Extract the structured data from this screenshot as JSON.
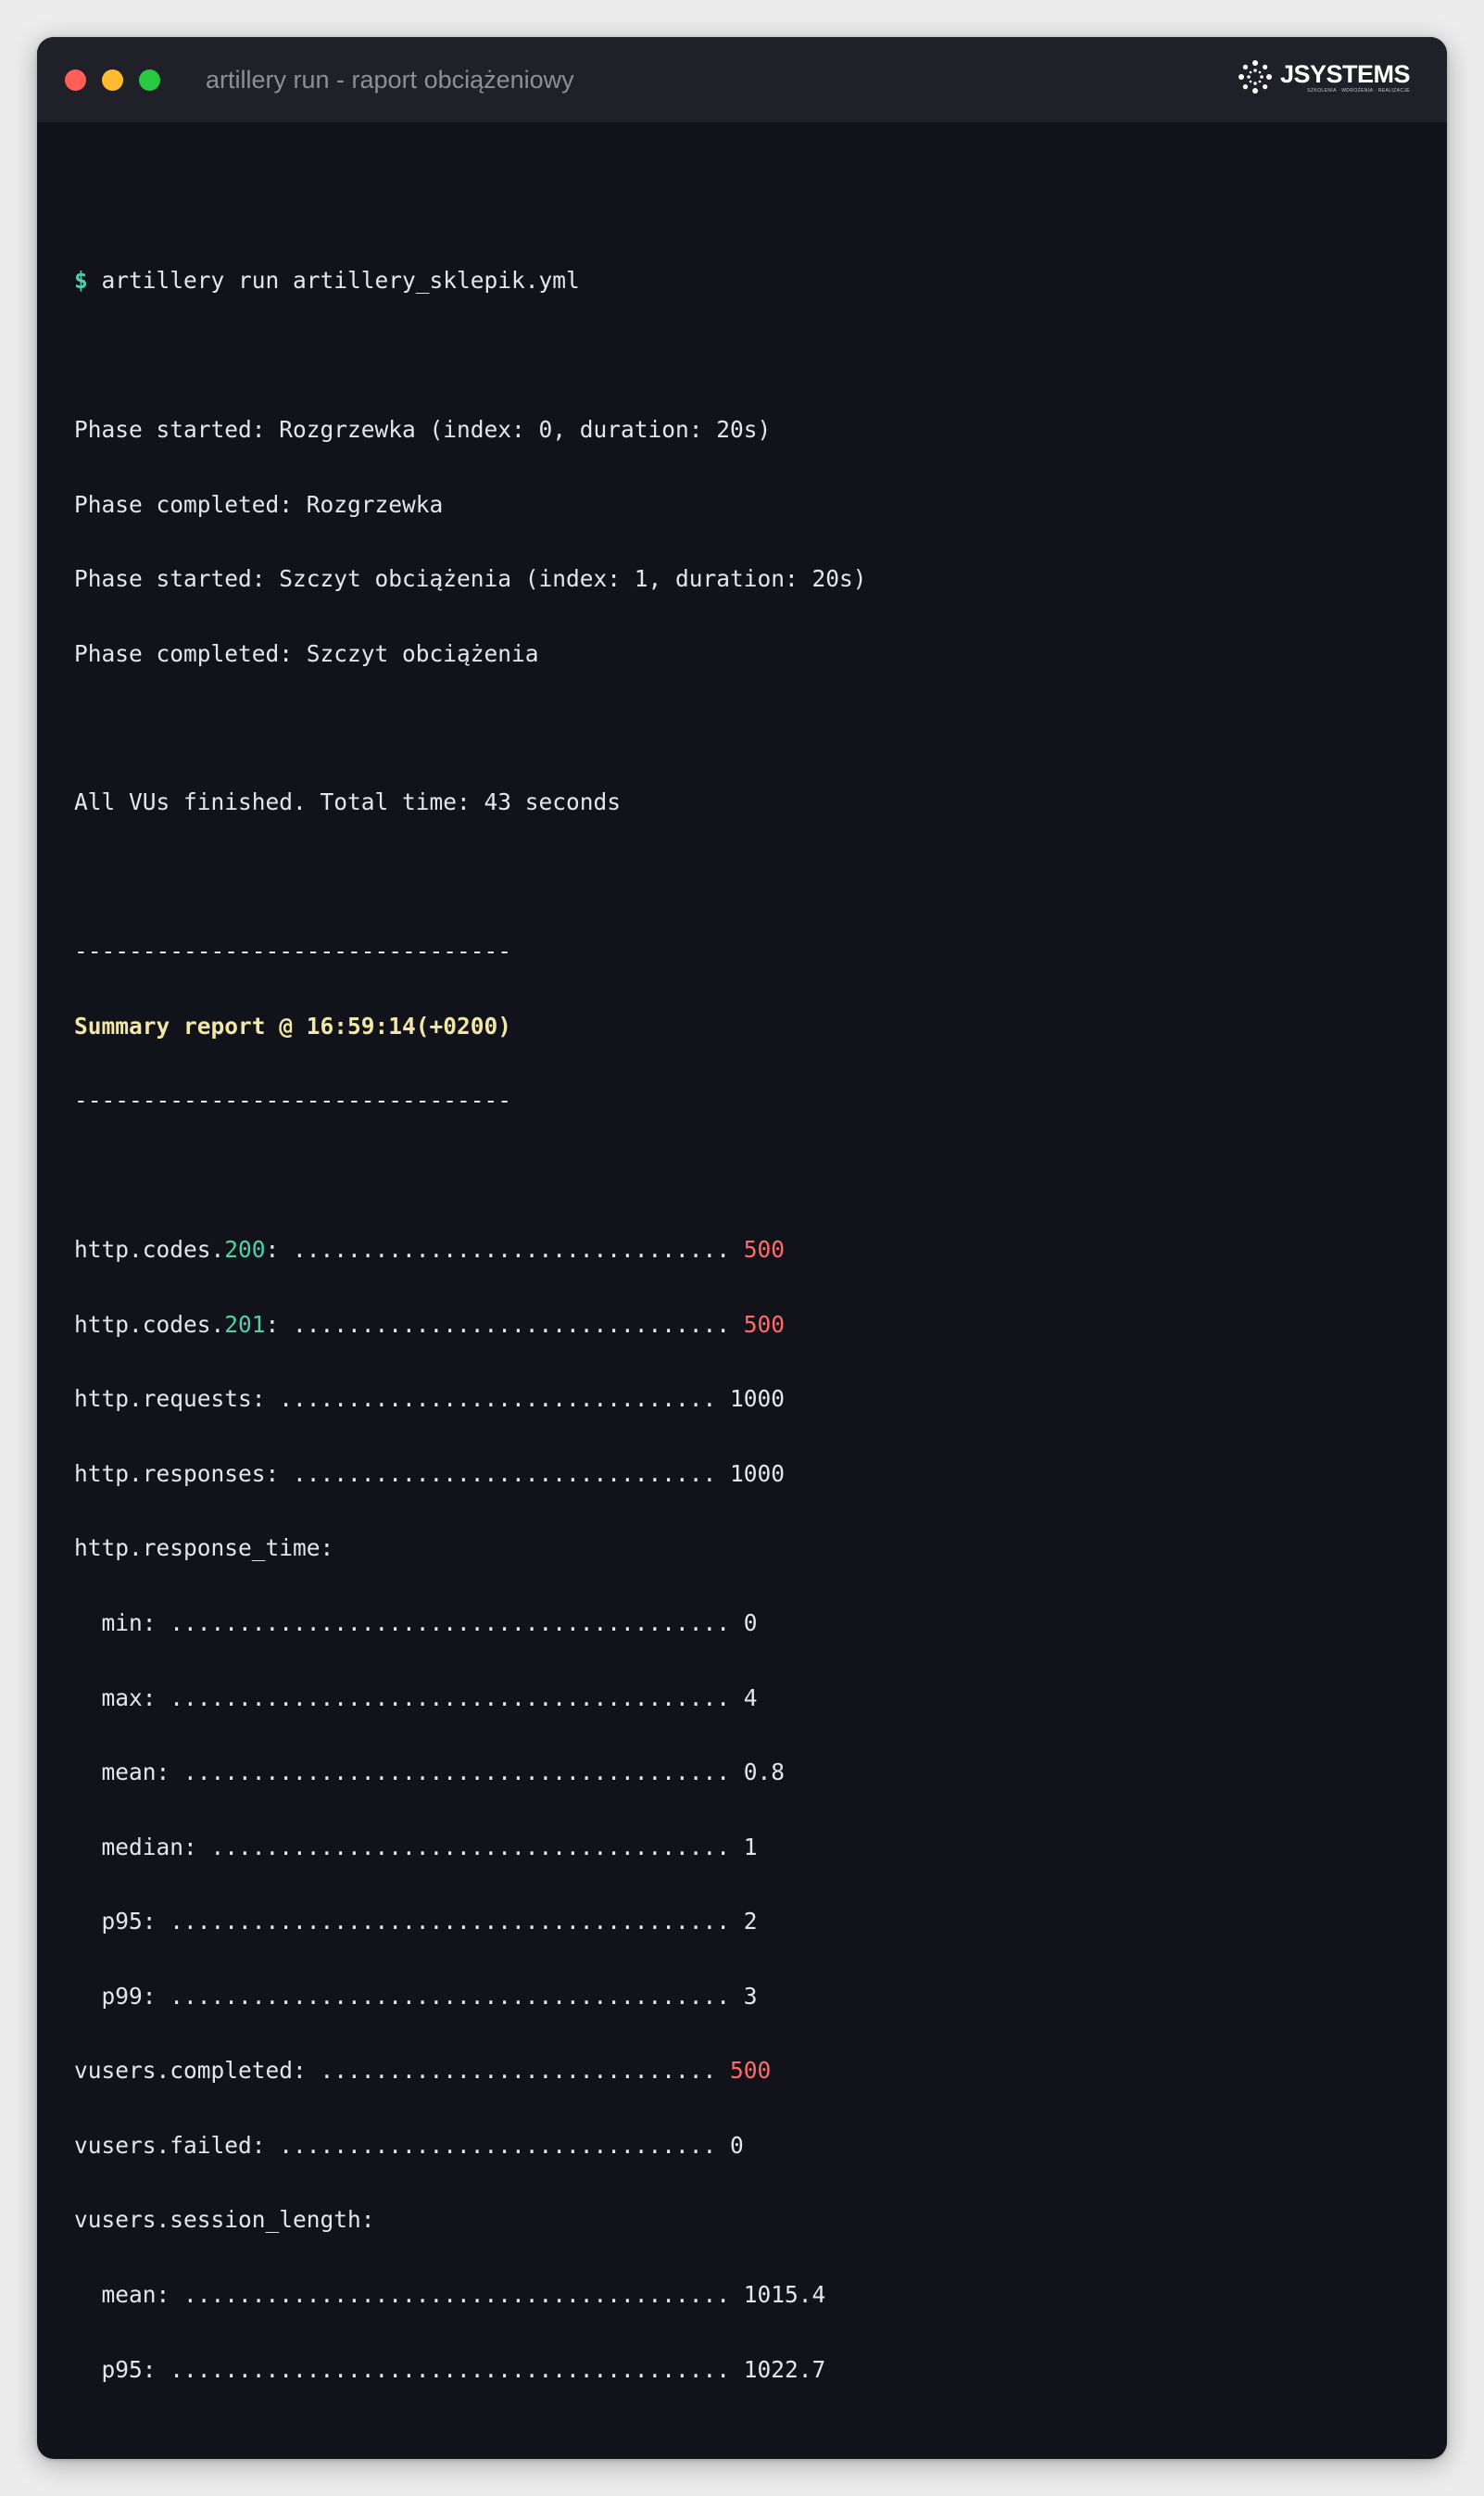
{
  "window": {
    "title": "artillery run - raport obciążeniowy",
    "logo": {
      "name": "JSYSTEMS",
      "tagline": "SZKOLENIA · WDROŻENIA · REALIZACJE"
    }
  },
  "terminal": {
    "prompt_symbol": "$",
    "command": "artillery run artillery_sklepik.yml",
    "phase_lines": [
      "Phase started: Rozgrzewka (index: 0, duration: 20s)",
      "Phase completed: Rozgrzewka",
      "Phase started: Szczyt obciążenia (index: 1, duration: 20s)",
      "Phase completed: Szczyt obciążenia"
    ],
    "finished_line": "All VUs finished. Total time: 43 seconds",
    "separator": "--------------------------------",
    "summary_title": "Summary report @ 16:59:14(+0200)",
    "metrics": {
      "codes_prefix": "http.codes.",
      "code_200": "200",
      "code_201": "201",
      "codes_200_dots": ": ................................ ",
      "codes_201_dots": ": ................................ ",
      "codes_200_value": "500",
      "codes_201_value": "500",
      "requests_label": "http.requests: ................................ ",
      "requests_value": "1000",
      "responses_label": "http.responses: ............................... ",
      "responses_value": "1000",
      "response_time_label": "http.response_time:",
      "rt_min_label": "  min: ......................................... ",
      "rt_min_value": "0",
      "rt_max_label": "  max: ......................................... ",
      "rt_max_value": "4",
      "rt_mean_label": "  mean: ........................................ ",
      "rt_mean_value": "0.8",
      "rt_median_label": "  median: ...................................... ",
      "rt_median_value": "1",
      "rt_p95_label": "  p95: ......................................... ",
      "rt_p95_value": "2",
      "rt_p99_label": "  p99: ......................................... ",
      "rt_p99_value": "3",
      "vusers_completed_label": "vusers.completed: ............................. ",
      "vusers_completed_value": "500",
      "vusers_failed_label": "vusers.failed: ................................ ",
      "vusers_failed_value": "0",
      "session_length_label": "vusers.session_length:",
      "sl_mean_label": "  mean: ........................................ ",
      "sl_mean_value": "1015.4",
      "sl_p95_label": "  p95: ......................................... ",
      "sl_p95_value": "1022.7"
    }
  },
  "colors": {
    "background": "#ececed",
    "window_bg": "#12131a",
    "titlebar_bg": "#1f2028",
    "prompt": "#4fd1a5",
    "summary": "#f1e7a8",
    "highlight_red": "#ff6b6b",
    "text": "#e6e6ea"
  }
}
